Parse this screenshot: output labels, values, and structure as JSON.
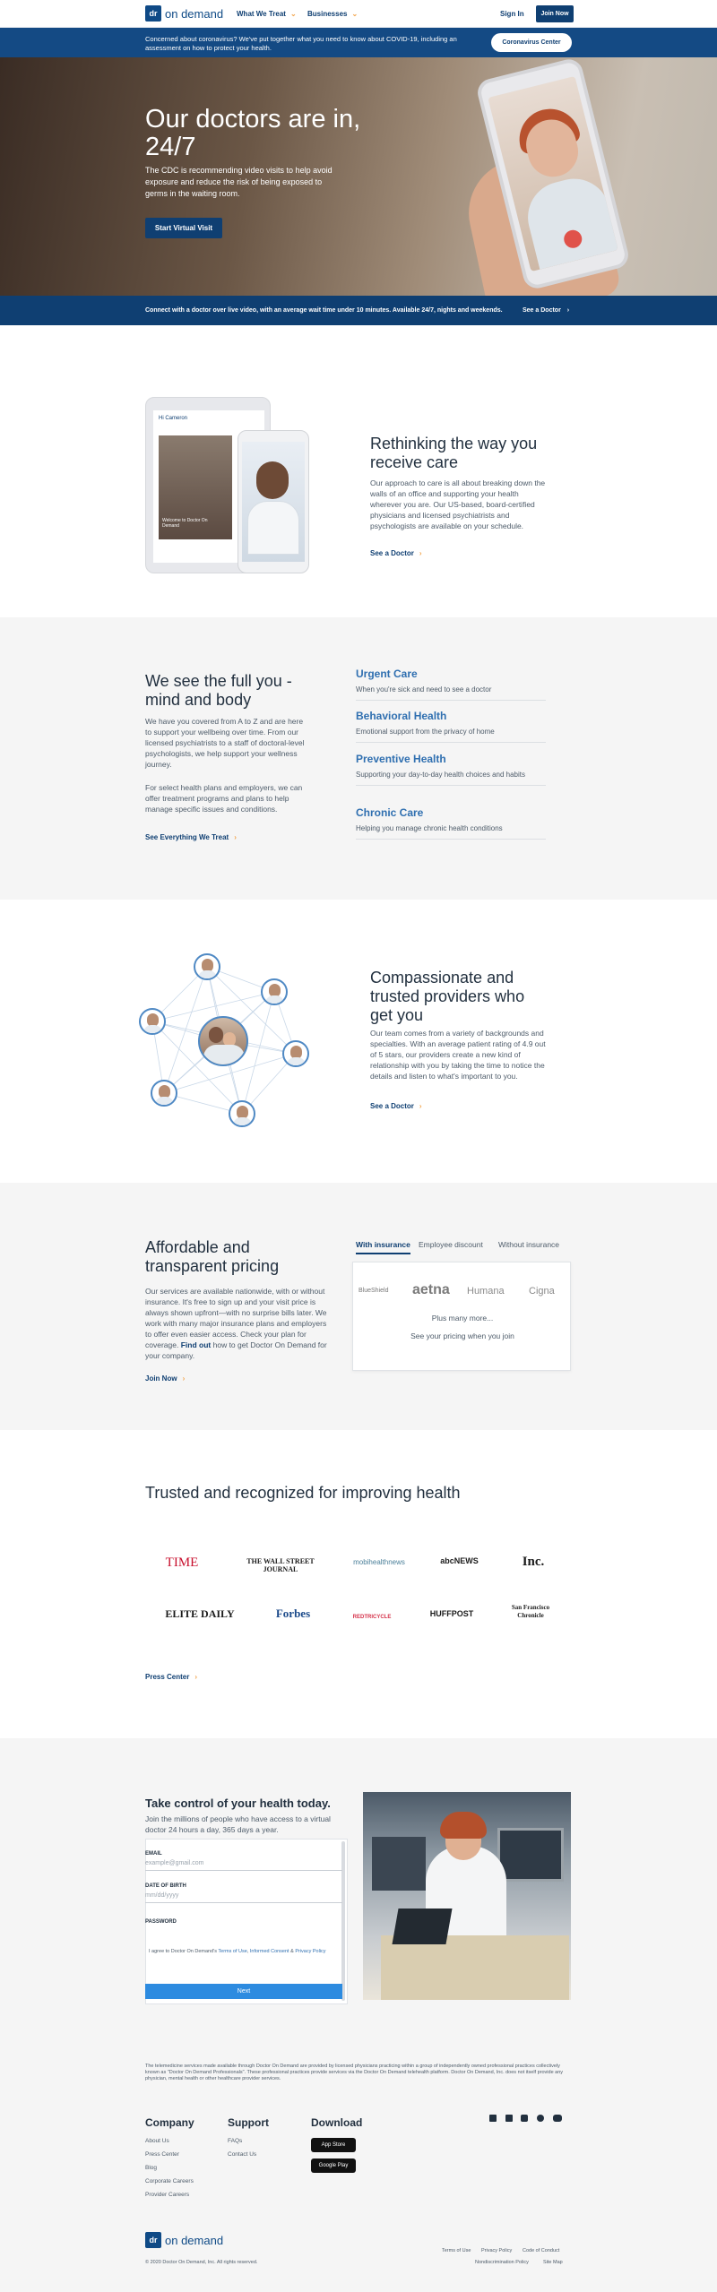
{
  "header": {
    "logo_mark": "dr",
    "logo_text": "on demand",
    "nav": [
      "What We Treat",
      "Businesses"
    ],
    "sign_in": "Sign In",
    "join": "Join Now"
  },
  "covid": {
    "text": "Concerned about coronavirus? We've put together what you need to know about COVID-19, including an assessment on how to protect your health.",
    "button": "Coronavirus Center"
  },
  "hero": {
    "title": "Our doctors are in, 24/7",
    "subtitle": "The CDC is recommending video visits to help avoid exposure and reduce the risk of being exposed to germs in the waiting room.",
    "cta": "Start Virtual Visit"
  },
  "strip": {
    "text": "Connect with a doctor over live video, with an average wait time under 10 minutes. Available 24/7, nights and weekends.",
    "link": "See a Doctor"
  },
  "rethinking": {
    "title": "Rethinking the way you receive care",
    "body": "Our approach to care is all about breaking down the walls of an office and supporting your health wherever you are. Our US-based, board-certified physicians and licensed psychiatrists and psychologists are available on your schedule.",
    "link": "See a Doctor",
    "tablet_brand": "Hi Cameron",
    "tablet_caption": "Welcome to Doctor On Demand"
  },
  "fullyou": {
    "title": "We see the full you - mind and body",
    "body1": "We have you covered from A to Z and are here to support your wellbeing over time. From our licensed psychiatrists to a staff of doctoral-level psychologists, we help support your wellness journey.",
    "body2": "For select health plans and employers, we can offer treatment programs and plans to help manage specific issues and conditions.",
    "link": "See Everything We Treat",
    "services": [
      {
        "name": "Urgent Care",
        "desc": "When you're sick and need to see a doctor"
      },
      {
        "name": "Behavioral Health",
        "desc": "Emotional support from the privacy of home"
      },
      {
        "name": "Preventive Health",
        "desc": "Supporting your day-to-day health choices and habits"
      },
      {
        "name": "Chronic Care",
        "desc": "Helping you manage chronic health conditions"
      }
    ]
  },
  "providers": {
    "title": "Compassionate and trusted providers who get you",
    "body": "Our team comes from a variety of backgrounds and specialties. With an average patient rating of 4.9 out of 5 stars, our providers create a new kind of relationship with you by taking the time to notice the details and listen to what's important to you.",
    "link": "See a Doctor"
  },
  "pricing": {
    "title": "Affordable and transparent pricing",
    "body_pre": "Our services are available nationwide, with or without insurance. It's free to sign up and your visit price is always shown upfront—with no surprise bills later. We work with many major insurance plans and employers to offer even easier access. Check your plan for coverage.",
    "find_out": "Find out",
    "body_post": "how to get Doctor On Demand for your company.",
    "link": "Join Now",
    "tabs": [
      "With insurance",
      "Employee discount",
      "Without insurance"
    ],
    "insurers": [
      "BlueShield",
      "aetna",
      "Humana",
      "Cigna"
    ],
    "more": "Plus many more...",
    "see_pricing": "See your pricing when you join"
  },
  "trusted": {
    "title": "Trusted and recognized for improving health",
    "logos_row1": [
      "TIME",
      "THE WALL STREET JOURNAL",
      "mobihealthnews",
      "abcNEWS",
      "Inc."
    ],
    "logos_row2": [
      "ELITE DAILY",
      "Forbes",
      "REDTRICYCLE",
      "HUFFPOST",
      "San Francisco Chronicle"
    ],
    "link": "Press Center"
  },
  "signup": {
    "title": "Take control of your health today.",
    "body": "Join the millions of people who have access to a virtual doctor 24 hours a day, 365 days a year.",
    "email_label": "EMAIL",
    "email_placeholder": "example@gmail.com",
    "dob_label": "DATE OF BIRTH",
    "dob_placeholder": "mm/dd/yyyy",
    "password_label": "PASSWORD",
    "agree_pre": "I agree to Doctor On Demand's",
    "agree_terms": "Terms of Use",
    "agree_consent": "Informed Consent",
    "agree_amp": "&",
    "agree_privacy": "Privacy Policy",
    "next": "Next"
  },
  "footer": {
    "disclaimer": "The telemedicine services made available through Doctor On Demand are provided by licensed physicians practicing within a group of independently owned professional practices collectively known as \"Doctor On Demand Professionals\". These professional practices provide services via the Doctor On Demand telehealth platform. Doctor On Demand, Inc. does not itself provide any physician, mental health or other healthcare provider services.",
    "company_title": "Company",
    "company_links": [
      "About Us",
      "Press Center",
      "Blog",
      "Corporate Careers",
      "Provider Careers"
    ],
    "support_title": "Support",
    "support_links": [
      "FAQs",
      "Contact Us"
    ],
    "download_title": "Download",
    "app_store": "App Store",
    "google_play": "Google Play",
    "social": [
      "facebook-icon",
      "linkedin-icon",
      "instagram-icon",
      "twitter-icon",
      "youtube-icon"
    ],
    "copyright": "© 2020 Doctor On Demand, Inc. All rights reserved.",
    "legal_links": [
      "Terms of Use",
      "Privacy Policy",
      "Code of Conduct",
      "Nondiscrimination Policy",
      "Site Map"
    ]
  },
  "colors": {
    "navy": "#0f3f72",
    "orange": "#f2a44b",
    "blue": "#2f6fb0",
    "button_blue": "#2d8be0"
  }
}
